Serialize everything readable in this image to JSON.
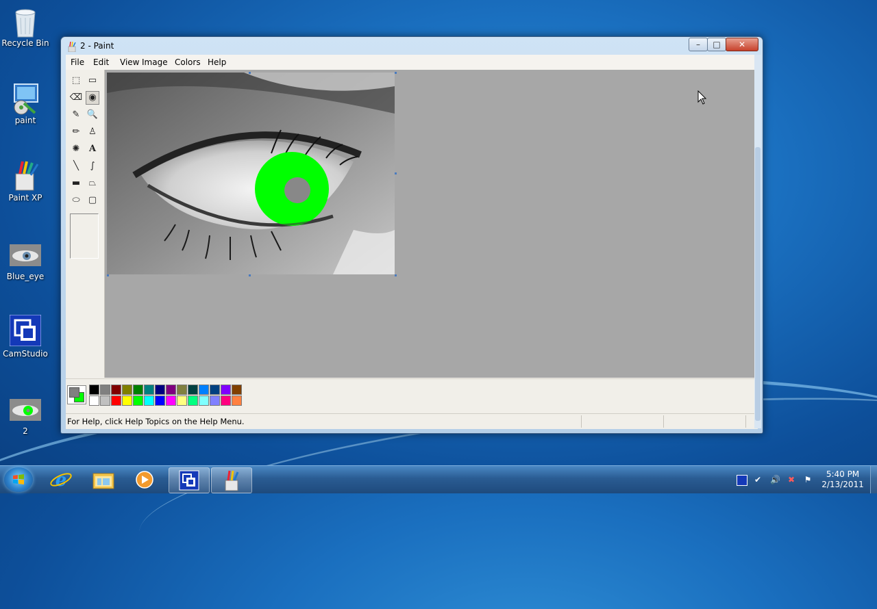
{
  "desktop": {
    "icons": [
      {
        "label": "Recycle Bin",
        "icon": "recycle-bin-icon"
      },
      {
        "label": "paint",
        "icon": "paint-program-icon"
      },
      {
        "label": "Paint XP",
        "icon": "paint-xp-icon"
      },
      {
        "label": "Blue_eye",
        "icon": "image-thumbnail-icon"
      },
      {
        "label": "CamStudio",
        "icon": "camstudio-icon"
      },
      {
        "label": "2",
        "icon": "image-thumbnail-icon"
      }
    ]
  },
  "window": {
    "title": "2 - Paint",
    "controls": {
      "minimize": "–",
      "maximize": "□",
      "close": "✕"
    },
    "menu": [
      "File",
      "Edit",
      "View",
      "Image",
      "Colors",
      "Help"
    ],
    "status_text": "For Help, click Help Topics on the Help Menu.",
    "active_tool": "fill-with-color",
    "tools": [
      {
        "name": "free-form-select",
        "glyph": "⬚"
      },
      {
        "name": "select",
        "glyph": "▭"
      },
      {
        "name": "eraser",
        "glyph": "⌫"
      },
      {
        "name": "fill-with-color",
        "glyph": "◉"
      },
      {
        "name": "pick-color",
        "glyph": "✎"
      },
      {
        "name": "magnifier",
        "glyph": "🔍"
      },
      {
        "name": "pencil",
        "glyph": "✏"
      },
      {
        "name": "brush",
        "glyph": "♙"
      },
      {
        "name": "airbrush",
        "glyph": "✺"
      },
      {
        "name": "text",
        "glyph": "A"
      },
      {
        "name": "line",
        "glyph": "╲"
      },
      {
        "name": "curve",
        "glyph": "∫"
      },
      {
        "name": "rectangle",
        "glyph": "▬"
      },
      {
        "name": "polygon",
        "glyph": "⏢"
      },
      {
        "name": "ellipse",
        "glyph": "⬭"
      },
      {
        "name": "rounded-rectangle",
        "glyph": "▢"
      }
    ],
    "foreground_color": "#808080",
    "background_color": "#00ff00",
    "palette_top": [
      "#000000",
      "#808080",
      "#800000",
      "#808000",
      "#008000",
      "#008080",
      "#000080",
      "#800080",
      "#808040",
      "#004040",
      "#0080ff",
      "#004080",
      "#8000ff",
      "#804000"
    ],
    "palette_bottom": [
      "#ffffff",
      "#c0c0c0",
      "#ff0000",
      "#ffff00",
      "#00ff00",
      "#00ffff",
      "#0000ff",
      "#ff00ff",
      "#ffff80",
      "#00ff80",
      "#80ffff",
      "#8080ff",
      "#ff0080",
      "#ff8040"
    ]
  },
  "taskbar": {
    "pinned": [
      "internet-explorer-icon",
      "windows-explorer-icon",
      "media-player-icon",
      "camstudio-icon",
      "paint-icon"
    ],
    "tray": [
      "camstudio-tray-icon",
      "safely-remove-icon",
      "volume-icon",
      "network-icon",
      "action-center-icon"
    ],
    "time": "5:40 PM",
    "date": "2/13/2011"
  }
}
